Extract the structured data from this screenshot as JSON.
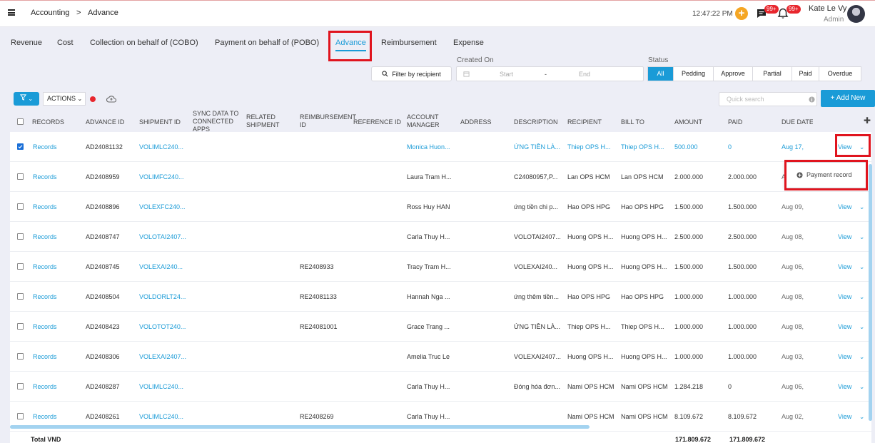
{
  "header": {
    "breadcrumb": [
      "Accounting",
      ">",
      "Advance"
    ],
    "clock": "12:47:22 PM",
    "messages_badge": "99+",
    "notifications_badge": "99+",
    "user_name": "Kate Le Vy",
    "user_role": "Admin"
  },
  "tabs": [
    "Revenue",
    "Cost",
    "Collection on behalf of (COBO)",
    "Payment on behalf of (POBO)",
    "Advance",
    "Reimbursement",
    "Expense"
  ],
  "active_tab": "Advance",
  "filters": {
    "filter_by_recipient": "Filter by recipient",
    "created_on_label": "Created On",
    "start_placeholder": "Start",
    "date_sep": "-",
    "end_placeholder": "End",
    "status_label": "Status",
    "status_options": [
      "All",
      "Pedding",
      "Approve",
      "Partial",
      "Paid",
      "Overdue"
    ],
    "status_selected": "All"
  },
  "toolbar": {
    "actions_label": "ACTIONS",
    "quick_search_placeholder": "Quick search",
    "add_new_label": "+ Add New"
  },
  "table": {
    "columns": [
      "RECORDS",
      "ADVANCE ID",
      "SHIPMENT ID",
      "SYNC DATA TO CONNECTED APPS",
      "RELATED SHIPMENT",
      "REIMBURSEMENT ID",
      "REFERENCE ID",
      "ACCOUNT MANAGER",
      "ADDRESS",
      "DESCRIPTION",
      "RECIPIENT",
      "BILL TO",
      "AMOUNT",
      "PAID",
      "DUE DATE"
    ],
    "rows": [
      {
        "records": "Records",
        "advance_id": "AD24081132",
        "shipment_id": "VOLIMLC240...",
        "reimb_id": "",
        "manager": "Monica Huon...",
        "description": "ỨNG TIỀN LÀ...",
        "recipient": "Thiep OPS H...",
        "bill_to": "Thiep OPS H...",
        "amount": "500.000",
        "paid": "0",
        "due": "Aug 17,",
        "view": "View",
        "checked": true
      },
      {
        "records": "Records",
        "advance_id": "AD2408959",
        "shipment_id": "VOLIMFC240...",
        "reimb_id": "",
        "manager": "Laura Tram H...",
        "description": "C24080957,P...",
        "recipient": "Lan OPS HCM",
        "bill_to": "Lan OPS HCM",
        "amount": "2.000.000",
        "paid": "2.000.000",
        "due": "A",
        "view": "",
        "checked": false
      },
      {
        "records": "Records",
        "advance_id": "AD2408896",
        "shipment_id": "VOLEXFC240...",
        "reimb_id": "",
        "manager": "Ross Huy HAN",
        "description": "ứng tiền chi p...",
        "recipient": "Hao OPS HPG",
        "bill_to": "Hao OPS HPG",
        "amount": "1.500.000",
        "paid": "1.500.000",
        "due": "Aug 09,",
        "view": "View",
        "checked": false
      },
      {
        "records": "Records",
        "advance_id": "AD2408747",
        "shipment_id": "VOLOTAI2407...",
        "reimb_id": "",
        "manager": "Carla Thuy H...",
        "description": "VOLOTAI2407...",
        "recipient": "Huong OPS H...",
        "bill_to": "Huong OPS H...",
        "amount": "2.500.000",
        "paid": "2.500.000",
        "due": "Aug 08,",
        "view": "View",
        "checked": false
      },
      {
        "records": "Records",
        "advance_id": "AD2408745",
        "shipment_id": "VOLEXAI240...",
        "reimb_id": "RE2408933",
        "manager": "Tracy Tram H...",
        "description": "VOLEXAI240...",
        "recipient": "Huong OPS H...",
        "bill_to": "Huong OPS H...",
        "amount": "1.500.000",
        "paid": "1.500.000",
        "due": "Aug 06,",
        "view": "View",
        "checked": false
      },
      {
        "records": "Records",
        "advance_id": "AD2408504",
        "shipment_id": "VOLDORLT24...",
        "reimb_id": "RE24081133",
        "manager": "Hannah Nga ...",
        "description": "ứng thêm tiền...",
        "recipient": "Hao OPS HPG",
        "bill_to": "Hao OPS HPG",
        "amount": "1.000.000",
        "paid": "1.000.000",
        "due": "Aug 08,",
        "view": "View",
        "checked": false
      },
      {
        "records": "Records",
        "advance_id": "AD2408423",
        "shipment_id": "VOLOTOT240...",
        "reimb_id": "RE24081001",
        "manager": "Grace Trang ...",
        "description": "ỨNG TIỀN LÀ...",
        "recipient": "Thiep OPS H...",
        "bill_to": "Thiep OPS H...",
        "amount": "1.000.000",
        "paid": "1.000.000",
        "due": "Aug 08,",
        "view": "View",
        "checked": false
      },
      {
        "records": "Records",
        "advance_id": "AD2408306",
        "shipment_id": "VOLEXAI2407...",
        "reimb_id": "",
        "manager": "Amelia Truc Le",
        "description": "VOLEXAI2407...",
        "recipient": "Huong OPS H...",
        "bill_to": "Huong OPS H...",
        "amount": "1.000.000",
        "paid": "1.000.000",
        "due": "Aug 03,",
        "view": "View",
        "checked": false
      },
      {
        "records": "Records",
        "advance_id": "AD2408287",
        "shipment_id": "VOLIMLC240...",
        "reimb_id": "",
        "manager": "Carla Thuy H...",
        "description": "Đóng hóa đơn...",
        "recipient": "Nami OPS HCM",
        "bill_to": "Nami OPS HCM",
        "amount": "1.284.218",
        "paid": "0",
        "due": "Aug 06,",
        "view": "View",
        "checked": false
      },
      {
        "records": "Records",
        "advance_id": "AD2408261",
        "shipment_id": "VOLIMLC240...",
        "reimb_id": "RE2408269",
        "manager": "Carla Thuy H...",
        "description": "",
        "recipient": "Nami OPS HCM",
        "bill_to": "Nami OPS HCM",
        "amount": "8.109.672",
        "paid": "8.109.672",
        "due": "Aug 02,",
        "view": "View",
        "checked": false
      }
    ],
    "total_label": "Total VND",
    "total_amount": "171.809.672",
    "total_paid": "171.809.672"
  },
  "popup": {
    "payment_record": "Payment record"
  },
  "colors": {
    "accent": "#1a9bd7",
    "highlight_box": "#e0141e",
    "badge": "#e8262d",
    "plus": "#f5a623"
  }
}
